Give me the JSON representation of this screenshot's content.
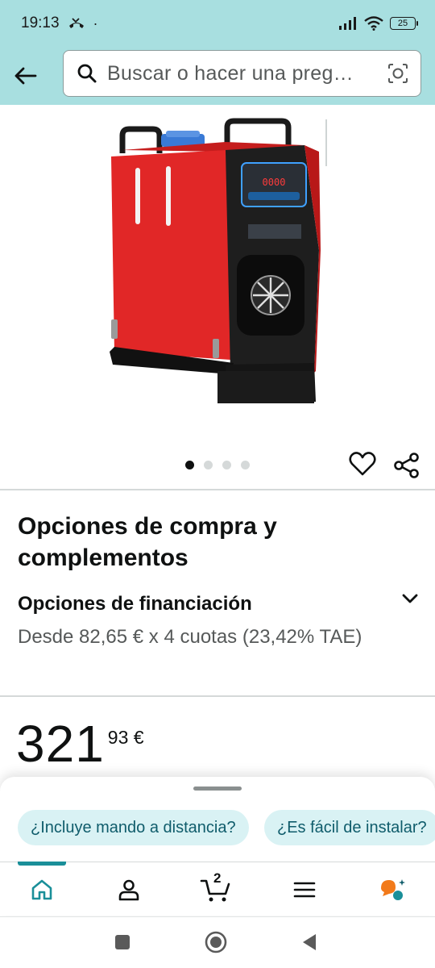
{
  "status_bar": {
    "time": "19:13",
    "battery": "25"
  },
  "search": {
    "placeholder": "Buscar o hacer una preg…"
  },
  "product": {
    "image_alt": "Calefactor diésel rojo con panel digital",
    "display_reading": "0000",
    "carousel_dots": 4,
    "active_dot": 0
  },
  "purchase_options": {
    "title": "Opciones de compra y complementos",
    "financing_title": "Opciones de financiación",
    "financing_text": "Desde 82,65 € x 4 cuotas (23,42% TAE)"
  },
  "price": {
    "whole": "321",
    "fraction": "93 €"
  },
  "suggestions": [
    "¿Incluye mando a distancia?",
    "¿Es fácil de instalar?"
  ],
  "bottom_nav": {
    "cart_count": "2",
    "active": "home"
  },
  "colors": {
    "accent": "#1a8f99",
    "header_bg": "#a8dfe0",
    "chip_bg": "#d9f2f4"
  }
}
